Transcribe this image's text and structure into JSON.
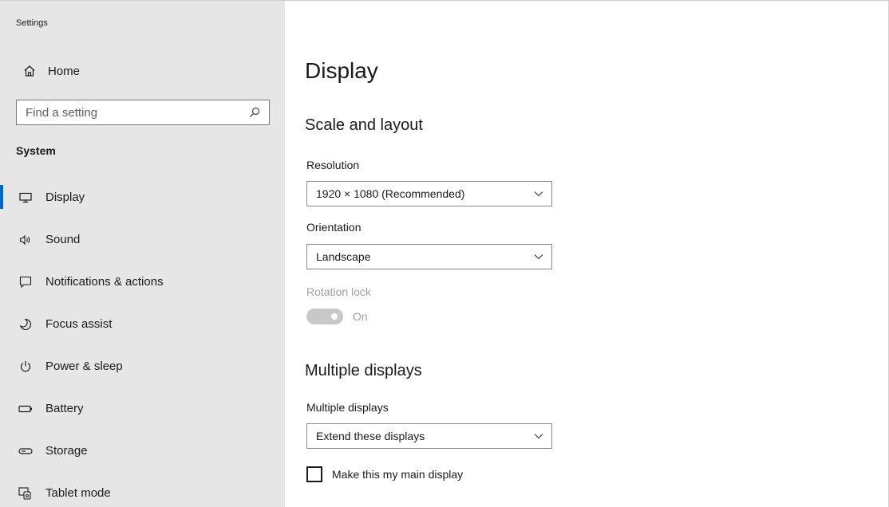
{
  "app": {
    "title": "Settings"
  },
  "sidebar": {
    "home_label": "Home",
    "search_placeholder": "Find a setting",
    "section_label": "System",
    "items": [
      {
        "label": "Display",
        "icon": "monitor-icon",
        "active": true
      },
      {
        "label": "Sound",
        "icon": "speaker-icon",
        "active": false
      },
      {
        "label": "Notifications & actions",
        "icon": "notification-icon",
        "active": false
      },
      {
        "label": "Focus assist",
        "icon": "moon-icon",
        "active": false
      },
      {
        "label": "Power & sleep",
        "icon": "power-icon",
        "active": false
      },
      {
        "label": "Battery",
        "icon": "battery-icon",
        "active": false
      },
      {
        "label": "Storage",
        "icon": "storage-icon",
        "active": false
      },
      {
        "label": "Tablet mode",
        "icon": "tablet-mode-icon",
        "active": false
      }
    ]
  },
  "main": {
    "title": "Display",
    "scale_section": {
      "heading": "Scale and layout",
      "resolution_label": "Resolution",
      "resolution_value": "1920 × 1080 (Recommended)",
      "orientation_label": "Orientation",
      "orientation_value": "Landscape",
      "rotation_lock_label": "Rotation lock",
      "rotation_lock_state": "On"
    },
    "multiple_section": {
      "heading": "Multiple displays",
      "multiple_label": "Multiple displays",
      "multiple_value": "Extend these displays",
      "main_display_label": "Make this my main display",
      "main_display_checked": false
    }
  },
  "colors": {
    "sidebar_bg": "#e6e6e6",
    "accent": "#0067c0",
    "disabled_text": "#a0a0a0"
  }
}
